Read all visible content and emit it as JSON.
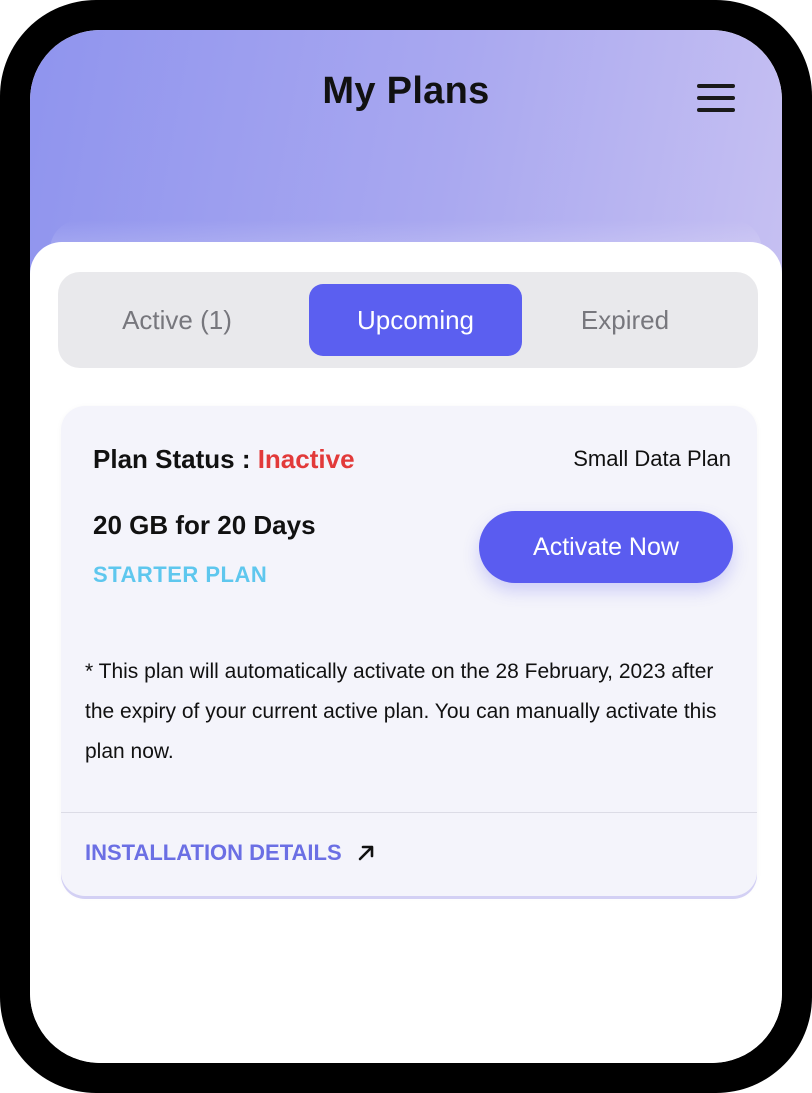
{
  "header": {
    "title": "My Plans",
    "menu_icon": "hamburger-menu-icon"
  },
  "tabs": [
    {
      "label": "Active (1)",
      "selected": false
    },
    {
      "label": "Upcoming",
      "selected": true
    },
    {
      "label": "Expired",
      "selected": false
    }
  ],
  "plan_card": {
    "status_label": "Plan Status : ",
    "status_value": "Inactive",
    "plan_type": "Small Data Plan",
    "plan_amount": "20 GB for 20 Days",
    "plan_name": "STARTER PLAN",
    "activate_label": "Activate Now",
    "note": "* This plan will automatically activate on the 28 February, 2023 after the expiry of your current active plan. You can manually activate this plan now.",
    "installation_link": "INSTALLATION DETAILS",
    "link_icon": "arrow-up-right-icon"
  },
  "colors": {
    "accent": "#5b5ff0",
    "status_inactive": "#e23a3a",
    "plan_name": "#5ec7ee",
    "link": "#6b6fe4"
  }
}
